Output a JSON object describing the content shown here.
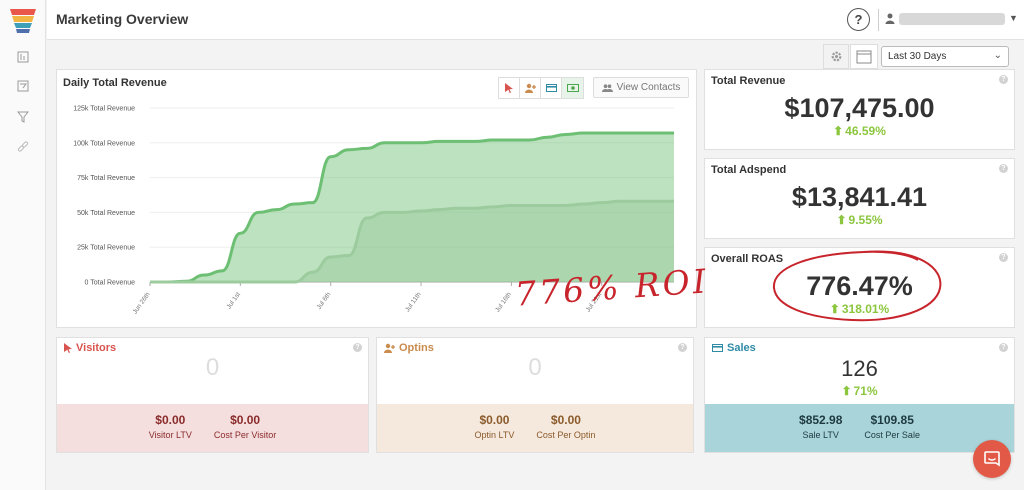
{
  "header": {
    "title": "Marketing Overview",
    "help": "?"
  },
  "toolbar": {
    "date_range": "Last 30 Days"
  },
  "chart": {
    "title": "Daily Total Revenue",
    "view_contacts": "View Contacts"
  },
  "chart_data": {
    "type": "area",
    "title": "Daily Total Revenue",
    "ylim": [
      0,
      125000
    ],
    "yticks": [
      {
        "value": 0,
        "label": "0 Total Revenue"
      },
      {
        "value": 25000,
        "label": "25k Total Revenue"
      },
      {
        "value": 50000,
        "label": "50k Total Revenue"
      },
      {
        "value": 75000,
        "label": "75k Total Revenue"
      },
      {
        "value": 100000,
        "label": "100k Total Revenue"
      },
      {
        "value": 125000,
        "label": "125k Total Revenue"
      }
    ],
    "xticks": [
      {
        "index": 0,
        "label": "Jun 26th"
      },
      {
        "index": 5,
        "label": "Jul 1st"
      },
      {
        "index": 10,
        "label": "Jul 6th"
      },
      {
        "index": 15,
        "label": "Jul 11th"
      },
      {
        "index": 20,
        "label": "Jul 16th"
      },
      {
        "index": 25,
        "label": "Jul 21st"
      }
    ],
    "series": [
      {
        "color": "#6cbf73",
        "values": [
          0,
          0,
          500,
          5000,
          8000,
          35000,
          50000,
          52000,
          56000,
          57000,
          90000,
          95000,
          96000,
          100000,
          100000,
          100000,
          101000,
          101000,
          101000,
          102000,
          102000,
          102000,
          104000,
          106000,
          107000,
          107000,
          107000,
          107000,
          107000,
          107000
        ]
      },
      {
        "color": "#9ccc9e",
        "values": [
          0,
          0,
          0,
          0,
          0,
          0,
          0,
          0,
          0,
          7000,
          18000,
          19000,
          46000,
          50000,
          50000,
          51000,
          52000,
          53000,
          53000,
          54000,
          55000,
          55000,
          55000,
          55000,
          56000,
          57000,
          58000,
          58000,
          58000,
          58000
        ]
      }
    ]
  },
  "stats": {
    "revenue": {
      "title": "Total Revenue",
      "value": "$107,475.00",
      "change": "46.59%"
    },
    "adspend": {
      "title": "Total Adspend",
      "value": "$13,841.41",
      "change": "9.55%"
    },
    "roas": {
      "title": "Overall ROAS",
      "value": "776.47%",
      "change": "318.01%"
    }
  },
  "annotation": {
    "text": "776% ROI"
  },
  "funnel": {
    "visitors": {
      "title": "Visitors",
      "count": "0",
      "m1_value": "$0.00",
      "m1_label": "Visitor LTV",
      "m2_value": "$0.00",
      "m2_label": "Cost Per Visitor"
    },
    "optins": {
      "title": "Optins",
      "count": "0",
      "m1_value": "$0.00",
      "m1_label": "Optin LTV",
      "m2_value": "$0.00",
      "m2_label": "Cost Per Optin"
    },
    "sales": {
      "title": "Sales",
      "count": "126",
      "change": "71%",
      "m1_value": "$852.98",
      "m1_label": "Sale LTV",
      "m2_value": "$109.85",
      "m2_label": "Cost Per Sale"
    }
  },
  "colors": {
    "positive": "#8cc63f",
    "visitors": "#d9534f",
    "optins": "#c98b4e",
    "sales": "#2f8ba6",
    "annotation": "#c8242c"
  },
  "icons": {
    "sidebar": [
      "dashboard-icon",
      "filter-icon",
      "funnel-icon",
      "link-icon"
    ],
    "chart_tools": [
      "pointer-icon",
      "user-plus-icon",
      "credit-card-icon",
      "money-icon"
    ]
  }
}
